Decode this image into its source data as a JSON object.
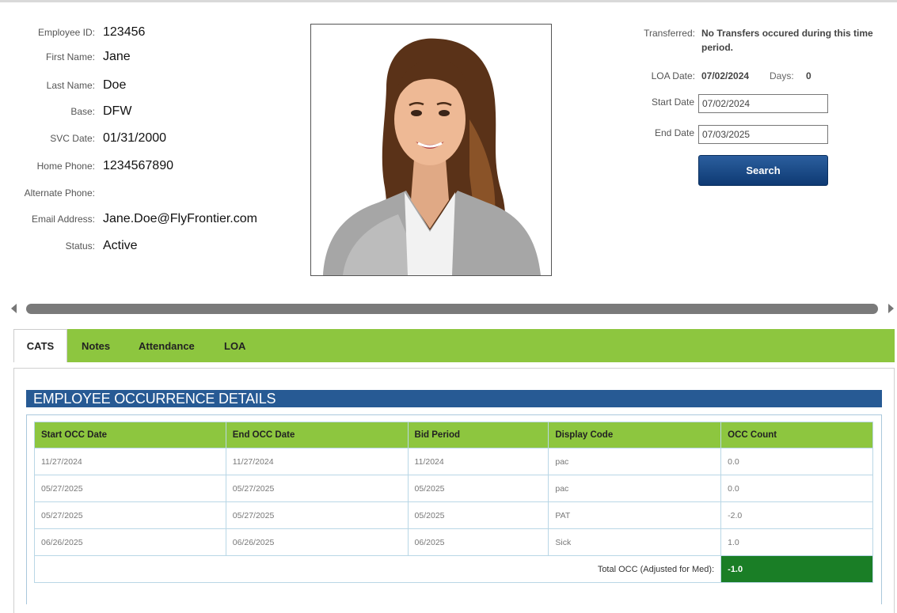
{
  "employee": {
    "fields": [
      {
        "label": "Employee ID:",
        "value": "123456"
      },
      {
        "label": "First Name:",
        "value": "Jane"
      },
      {
        "label": "Last Name:",
        "value": "Doe"
      },
      {
        "label": "Base:",
        "value": "DFW"
      },
      {
        "label": "SVC Date:",
        "value": "01/31/2000"
      },
      {
        "label": "Home Phone:",
        "value": "1234567890"
      },
      {
        "label": "Alternate Phone:",
        "value": ""
      },
      {
        "label": "Email Address:",
        "value": "Jane.Doe@FlyFrontier.com"
      },
      {
        "label": "Status:",
        "value": "Active"
      }
    ]
  },
  "transfer": {
    "label": "Transferred:",
    "value_line1": "No Transfers occured during this time",
    "value_line2": "period."
  },
  "loa": {
    "label": "LOA Date:",
    "value": "07/02/2024",
    "days_label": "Days:",
    "days_value": "0"
  },
  "filters": {
    "start_label": "Start Date",
    "start_value": "07/02/2024",
    "end_label": "End Date",
    "end_value": "07/03/2025",
    "search_label": "Search"
  },
  "tabs": [
    {
      "label": "CATS",
      "active": true
    },
    {
      "label": "Notes",
      "active": false
    },
    {
      "label": "Attendance",
      "active": false
    },
    {
      "label": "LOA",
      "active": false
    }
  ],
  "occurrences": {
    "title": "EMPLOYEE OCCURRENCE DETAILS",
    "columns": [
      "Start OCC Date",
      "End OCC Date",
      "Bid Period",
      "Display Code",
      "OCC Count"
    ],
    "rows": [
      [
        "11/27/2024",
        "11/27/2024",
        "11/2024",
        "pac",
        "0.0"
      ],
      [
        "05/27/2025",
        "05/27/2025",
        "05/2025",
        "pac",
        "0.0"
      ],
      [
        "05/27/2025",
        "05/27/2025",
        "05/2025",
        "PAT",
        "-2.0"
      ],
      [
        "06/26/2025",
        "06/26/2025",
        "06/2025",
        "Sick",
        "1.0"
      ]
    ],
    "total_label": "Total OCC (Adjusted for Med):",
    "total_value": "-1.0"
  },
  "colors": {
    "tab_green": "#8dc63f",
    "header_blue": "#275a94",
    "button_blue": "#0e3a73",
    "total_green": "#1a7e26"
  }
}
